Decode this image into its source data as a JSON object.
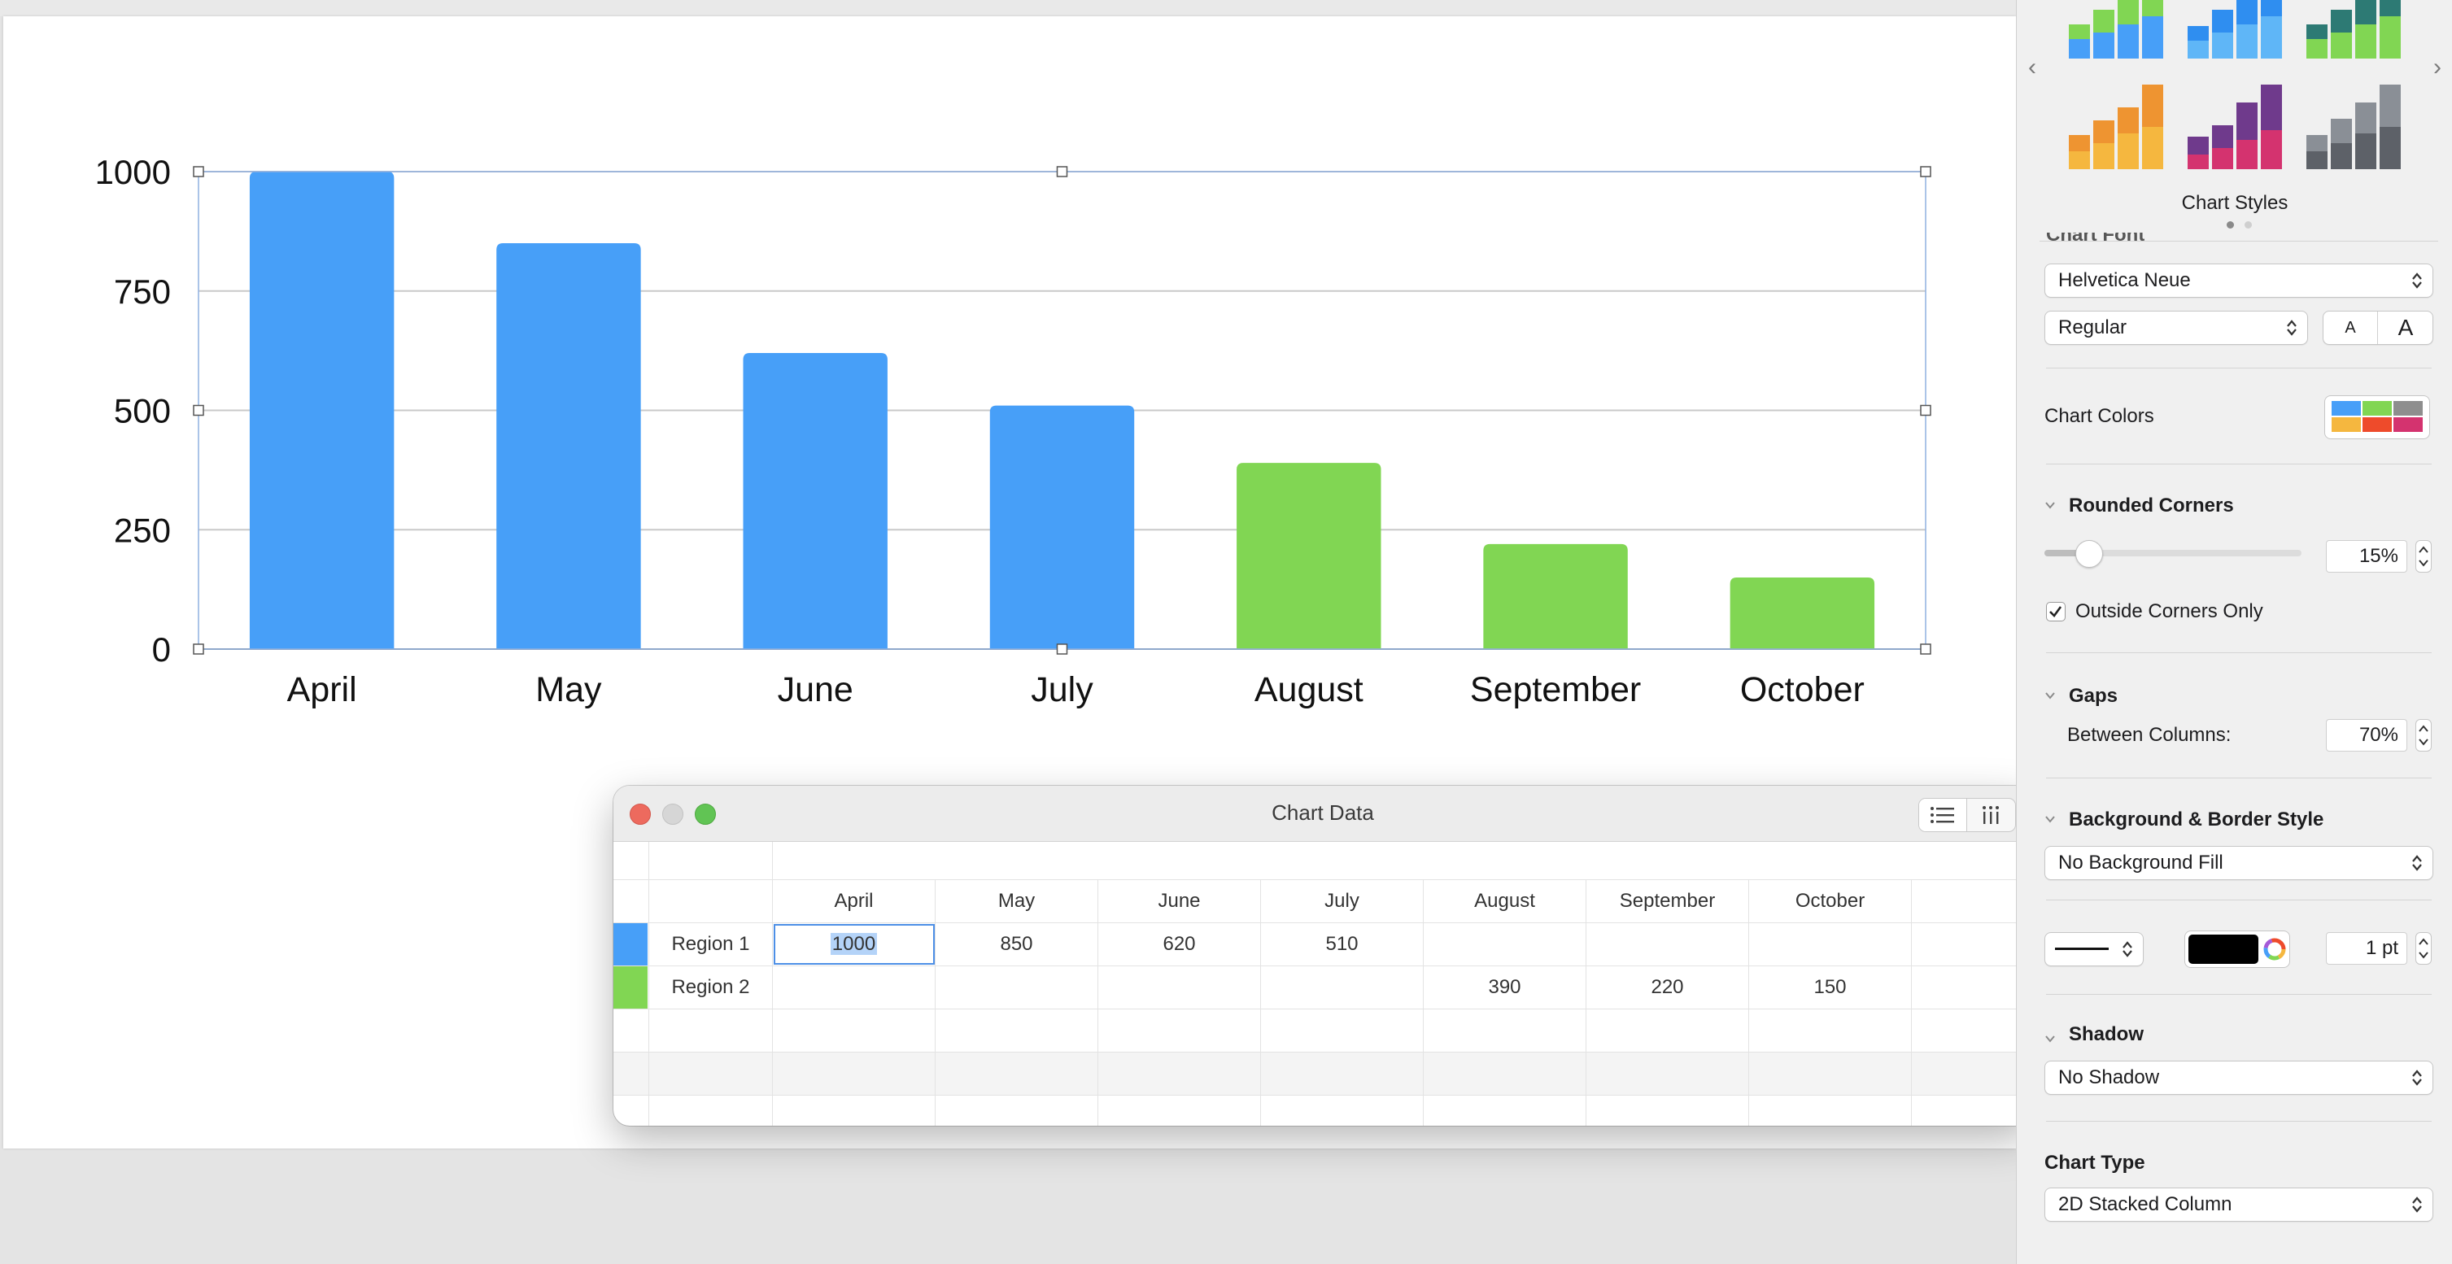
{
  "chart_data": {
    "type": "bar",
    "categories": [
      "April",
      "May",
      "June",
      "July",
      "August",
      "September",
      "October"
    ],
    "series": [
      {
        "name": "Region 1",
        "color": "#479ff8",
        "values": [
          1000,
          850,
          620,
          510,
          null,
          null,
          null
        ]
      },
      {
        "name": "Region 2",
        "color": "#81d653",
        "values": [
          null,
          null,
          null,
          null,
          390,
          220,
          150
        ]
      }
    ],
    "y_ticks": [
      "1000",
      "750",
      "500",
      "250",
      "0"
    ],
    "ylim": [
      0,
      1000
    ],
    "grid": true,
    "title": "",
    "xlabel": "",
    "ylabel": ""
  },
  "chart_data_window": {
    "title": "Chart Data",
    "columns": [
      "April",
      "May",
      "June",
      "July",
      "August",
      "September",
      "October"
    ],
    "rows": [
      {
        "label": "Region 1",
        "color": "#479ff8",
        "cells": [
          "1000",
          "850",
          "620",
          "510",
          "",
          "",
          ""
        ]
      },
      {
        "label": "Region 2",
        "color": "#81d653",
        "cells": [
          "",
          "",
          "",
          "",
          "390",
          "220",
          "150"
        ]
      }
    ],
    "selected_cell": "Region 1 / April"
  },
  "inspector": {
    "chart_styles_label": "Chart Styles",
    "chart_font_partial": "Chart Font",
    "font_family": "Helvetica Neue",
    "font_style": "Regular",
    "font_smaller": "A",
    "font_larger": "A",
    "chart_colors_label": "Chart Colors",
    "rounded_corners_label": "Rounded Corners",
    "rounded_corners_value": "15%",
    "rounded_corners_fraction": 0.15,
    "outside_corners_label": "Outside Corners Only",
    "outside_corners_checked": true,
    "gaps_label": "Gaps",
    "between_columns_label": "Between Columns:",
    "between_columns_value": "70%",
    "background_border_label": "Background & Border Style",
    "background_fill": "No Background Fill",
    "border_width": "1 pt",
    "shadow_label": "Shadow",
    "shadow_value": "No Shadow",
    "chart_type_label": "Chart Type",
    "chart_type_value": "2D Stacked Column"
  }
}
